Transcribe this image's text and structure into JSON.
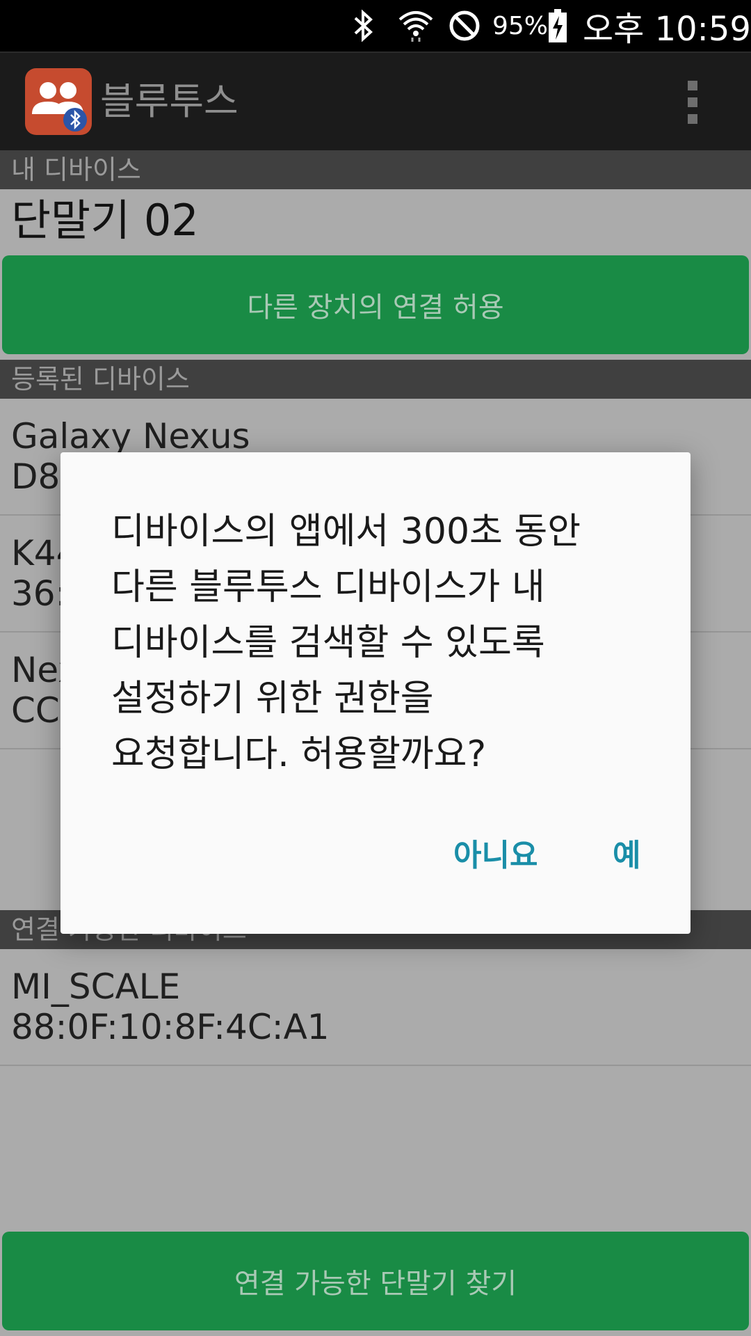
{
  "status_bar": {
    "battery_percent": "95%",
    "time": "오후 10:59",
    "icons": [
      "bluetooth-icon",
      "wifi-icon",
      "do-not-disturb-icon",
      "battery-charging-icon"
    ]
  },
  "action_bar": {
    "title": "블루투스",
    "icon": "bluetooth-users-app-icon",
    "menu_icon": "overflow-menu-icon"
  },
  "my_device": {
    "header": "내 디바이스",
    "name": "단말기 02",
    "allow_button": "다른 장치의 연결 허용"
  },
  "registered": {
    "header": "등록된 디바이스",
    "devices": [
      {
        "name": "Galaxy Nexus",
        "address": "D8:"
      },
      {
        "name": "K44",
        "address": "36:"
      },
      {
        "name": "Nex",
        "address": "CC"
      }
    ]
  },
  "available": {
    "header": "연결 가능한 디바이스",
    "devices": [
      {
        "name": "MI_SCALE",
        "address": "88:0F:10:8F:4C:A1"
      }
    ]
  },
  "find_button": "연결 가능한 단말기 찾기",
  "dialog": {
    "message_lines": [
      "디바이스의 앱에서 300초 동안",
      "다른 블루투스 디바이스가 내",
      "디바이스를 검색할 수 있도록",
      "설정하기 위한 권한을",
      "요청합니다. 허용할까요?"
    ],
    "negative": "아니요",
    "positive": "예"
  },
  "colors": {
    "green_button": "#198b45",
    "dialog_button_text": "#1a8ea8",
    "action_bar": "#1b1b1b"
  }
}
